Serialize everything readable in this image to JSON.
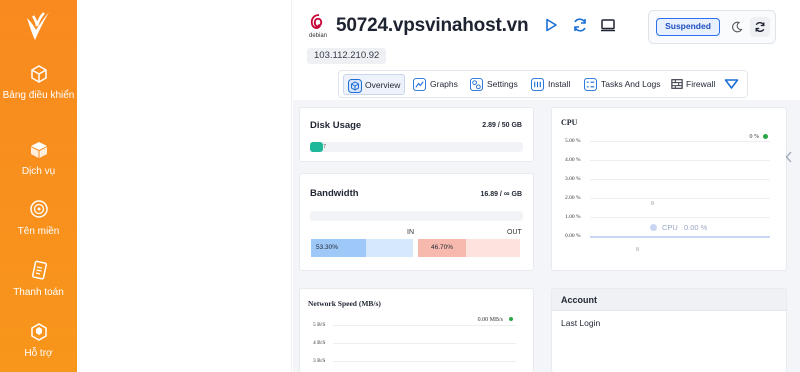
{
  "sidebar": {
    "items": [
      {
        "label": "Bảng điều khiển",
        "icon": "dashboard-icon"
      },
      {
        "label": "Dịch vụ",
        "icon": "box-icon"
      },
      {
        "label": "Tên miền",
        "icon": "globe-icon"
      },
      {
        "label": "Thanh toán",
        "icon": "invoice-icon"
      },
      {
        "label": "Hỗ trợ",
        "icon": "support-icon"
      }
    ]
  },
  "server": {
    "os": "debian",
    "hostname": "50724.vpsvinahost.vn",
    "ip": "103.112.210.92",
    "status": "Suspended"
  },
  "tabs": [
    "Overview",
    "Graphs",
    "Settings",
    "Install",
    "Tasks And Logs",
    "Firewall"
  ],
  "disk": {
    "title": "Disk Usage",
    "value": "2.89 / 50 GB",
    "percent_label": "7",
    "fraction": 0.06
  },
  "bandwidth": {
    "title": "Bandwidth",
    "value_prefix": "16.89 /",
    "value_suffix": "GB",
    "in_label": "IN",
    "out_label": "OUT",
    "in_percent": "53.30%",
    "out_percent": "46.70%"
  },
  "cpu": {
    "title": "CPU",
    "current": "0 %",
    "legend": "CPU",
    "legend_value": "0.00 %",
    "ticks": [
      "5.00 %",
      "4.00 %",
      "3.00 %",
      "2.00 %",
      "1.00 %",
      "0.00 %"
    ],
    "x_labels": [
      "8",
      "8"
    ]
  },
  "network": {
    "title": "Network Speed (MB/s)",
    "current": "0.00 MB/s",
    "ticks": [
      "5 B/S",
      "4 B/S",
      "3 B/S"
    ]
  },
  "account": {
    "title": "Account",
    "last_login_label": "Last Login"
  },
  "colors": {
    "sidebar": "#f7931e",
    "accent": "#2b6ef0",
    "disk_bar": "#1fb89a",
    "in_bar": "#9ec8f7",
    "out_bar": "#f7b9ae",
    "online_dot": "#27a845"
  }
}
